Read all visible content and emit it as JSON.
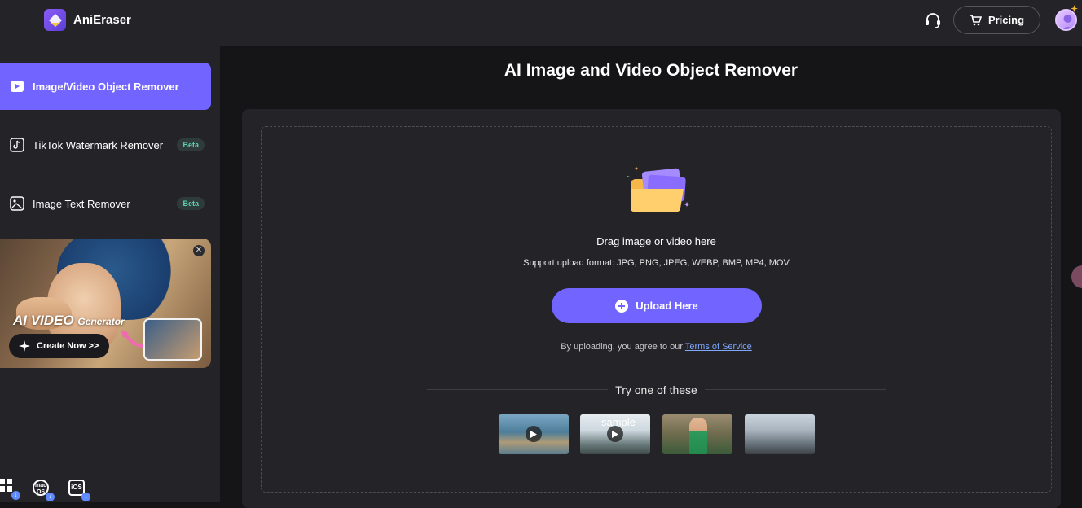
{
  "app": {
    "brand": "AniEraser",
    "pricing_label": "Pricing"
  },
  "sidebar": {
    "items": [
      {
        "label": "Image/Video Object Remover",
        "active": true,
        "icon": "play-icon"
      },
      {
        "label": "TikTok Watermark Remover",
        "badge": "Beta",
        "icon": "tiktok-icon"
      },
      {
        "label": "Image Text Remover",
        "badge": "Beta",
        "icon": "image-icon"
      }
    ],
    "banner": {
      "title_main": "AI VIDEO",
      "title_sub": "Generator",
      "cta": "Create Now >>"
    },
    "platforms": [
      {
        "name": "windows"
      },
      {
        "name": "macOS",
        "label": "mac OS"
      },
      {
        "name": "iOS",
        "label": "iOS"
      }
    ]
  },
  "main": {
    "title": "AI Image and Video Object Remover",
    "drag_text": "Drag image or video here",
    "formats": "Support upload format: JPG, PNG, JPEG, WEBP, BMP, MP4, MOV",
    "upload_label": "Upload Here",
    "agree_prefix": "By uploading, you agree to our ",
    "agree_link": "Terms of Service",
    "try_text": "Try one of these",
    "sample_alt": "sample"
  },
  "colors": {
    "accent": "#7264ff",
    "panel": "#232328",
    "background": "#151518"
  }
}
